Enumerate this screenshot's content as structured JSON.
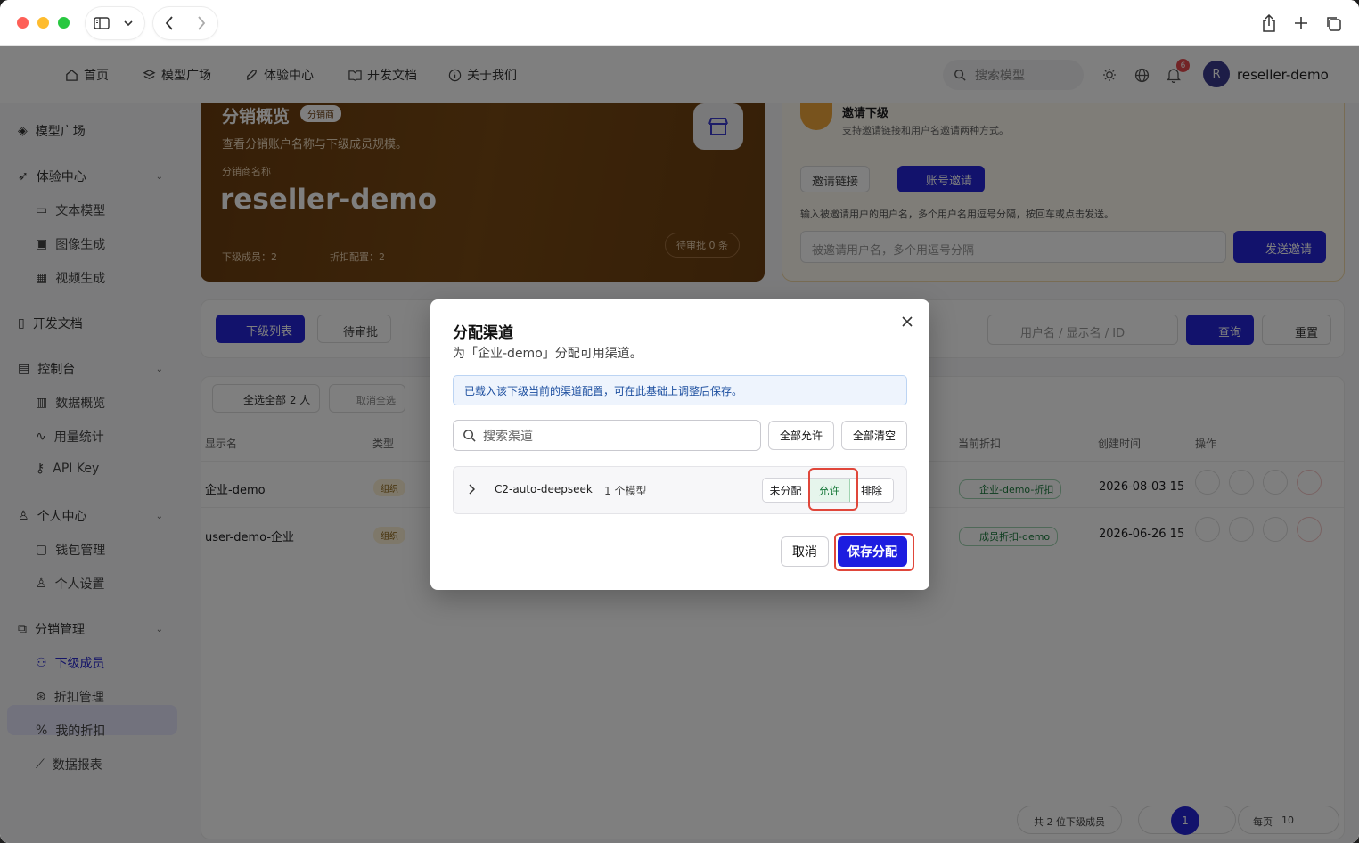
{
  "browser": {
    "icons": [
      "sidebar-icon",
      "chevron-down-icon",
      "back-icon",
      "forward-icon",
      "share-icon",
      "new-tab-icon",
      "tabs-overview-icon"
    ]
  },
  "topnav": {
    "items": [
      {
        "label": "首页",
        "icon": "home-icon"
      },
      {
        "label": "模型广场",
        "icon": "layers-icon"
      },
      {
        "label": "体验中心",
        "icon": "rocket-icon"
      },
      {
        "label": "开发文档",
        "icon": "book-icon"
      },
      {
        "label": "关于我们",
        "icon": "info-icon"
      }
    ],
    "search_placeholder": "搜索模型",
    "notification_count": "6",
    "avatar_initial": "R",
    "username": "reseller-demo"
  },
  "sidebar": {
    "model_square": "模型广场",
    "experience": "体验中心",
    "text_model": "文本模型",
    "image_gen": "图像生成",
    "video_gen": "视频生成",
    "dev_docs": "开发文档",
    "console": "控制台",
    "data_overview": "数据概览",
    "usage_stats": "用量统计",
    "api_key": "API Key",
    "personal": "个人中心",
    "wallet": "钱包管理",
    "settings": "个人设置",
    "reseller_mgmt": "分销管理",
    "members": "下级成员",
    "discount_mgmt": "折扣管理",
    "my_discount": "我的折扣",
    "reports": "数据报表"
  },
  "hero": {
    "title": "分销概览",
    "tag": "分销商",
    "desc": "查看分销账户名称与下级成员规模。",
    "name_label": "分销商名称",
    "name": "reseller-demo",
    "members": "下级成员：2",
    "discounts": "折扣配置：2",
    "pending": "待审批 0 条"
  },
  "invite": {
    "title": "邀请下级",
    "desc": "支持邀请链接和用户名邀请两种方式。",
    "tab_link": "邀请链接",
    "tab_account": "账号邀请",
    "hint": "输入被邀请用户的用户名，多个用户名用逗号分隔，按回车或点击发送。",
    "placeholder": "被邀请用户名，多个用逗号分隔",
    "send": "发送邀请"
  },
  "tabsbar": {
    "tab_list": "下级列表",
    "tab_pending": "待审批",
    "search_placeholder": "用户名 / 显示名 / ID",
    "query": "查询",
    "reset": "重置"
  },
  "table": {
    "select_all": "全选全部 2 人",
    "deselect_all": "取消全选",
    "headers": {
      "name": "显示名",
      "type": "类型",
      "discount": "当前折扣",
      "created": "创建时间",
      "ops": "操作"
    },
    "rows": [
      {
        "name": "企业-demo",
        "type": "组织",
        "discount": "企业-demo-折扣",
        "created": "2026-08-03 15"
      },
      {
        "name": "user-demo-企业",
        "type": "组织",
        "discount": "成员折扣-demo",
        "created": "2026-06-26 15"
      }
    ],
    "total": "共 2 位下级成员",
    "page": "1",
    "per_page_label": "每页",
    "per_page": "10"
  },
  "modal": {
    "title": "分配渠道",
    "subtitle": "为「企业-demo」分配可用渠道。",
    "notice": "已载入该下级当前的渠道配置，可在此基础上调整后保存。",
    "search_placeholder": "搜索渠道",
    "allow_all": "全部允许",
    "clear_all": "全部清空",
    "channel": {
      "name": "C2-auto-deepseek",
      "count": "1 个模型",
      "unassigned": "未分配",
      "allow": "允许",
      "exclude": "排除",
      "selected": "允许"
    },
    "cancel": "取消",
    "save": "保存分配"
  },
  "colors": {
    "primary": "#1d1de0",
    "allow_bg": "#e6f5ec",
    "allow_text": "#1a7a3c",
    "highlight": "#e0463a"
  }
}
